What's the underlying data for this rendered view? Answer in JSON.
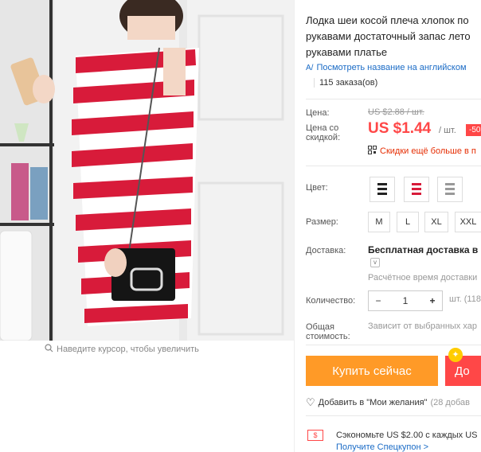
{
  "gallery": {
    "zoom_hint": "Наведите курсор, чтобы увеличить"
  },
  "product": {
    "title_lines": [
      "Лодка шеи косой плеча хлопок по",
      "рукавами достаточный запас лето",
      "рукавами платье"
    ],
    "translate_link": "Посмотреть название на английском",
    "orders": "115 заказа(ов)"
  },
  "price": {
    "label": "Цена:",
    "original": "US $2.88 / шт.",
    "discount_label": "Цена со скидкой:",
    "discount_label_line1": "Цена со",
    "discount_label_line2": "скидкой:",
    "discounted": "US $1.44",
    "per_unit": "/ шт.",
    "badge": "-50",
    "promo": "Скидки ещё больше в п"
  },
  "color": {
    "label": "Цвет:",
    "swatches": [
      "black-white",
      "red-white",
      "grey-white"
    ]
  },
  "size": {
    "label": "Размер:",
    "options": [
      "M",
      "L",
      "XL",
      "XXL"
    ]
  },
  "shipping": {
    "label": "Доставка:",
    "method": "Бесплатная доставка в Ru",
    "estimate": "Расчётное время доставки"
  },
  "quantity": {
    "label": "Количество:",
    "minus": "−",
    "value": "1",
    "plus": "+",
    "available": "шт. (118"
  },
  "total": {
    "label_line1": "Общая",
    "label_line2": "стоимость:",
    "value": "Зависит от выбранных хар"
  },
  "actions": {
    "buy_now": "Купить сейчас",
    "add_to_cart": "До",
    "wishlist": "Добавить в \"Мои желания\"",
    "wishlist_count": "(28 добав"
  },
  "coupon": {
    "text": "Сэкономьте US $2.00 с каждых US",
    "link": "Получите Спецкупон >"
  },
  "colors": {
    "accent_red": "#ff4747",
    "orange": "#ff9a27",
    "link_blue": "#1a6bc6"
  }
}
